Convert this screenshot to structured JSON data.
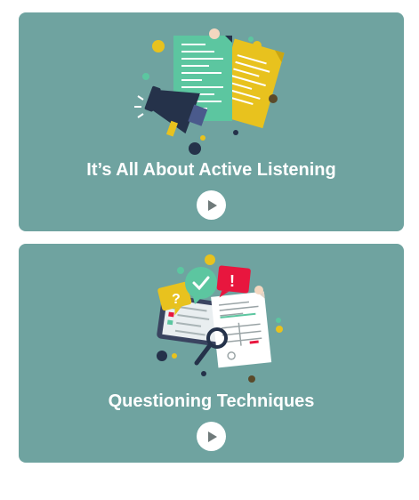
{
  "cards": [
    {
      "title": "It’s All About Active Listening",
      "illustration_icon": "megaphone-documents-icon",
      "play_icon": "play-icon"
    },
    {
      "title": "Questioning Techniques",
      "illustration_icon": "questions-checklist-magnifier-icon",
      "play_icon": "play-icon"
    }
  ],
  "colors": {
    "card_bg": "#6fa3a0",
    "title_text": "#ffffff",
    "play_bg": "#ffffff",
    "play_glyph": "#6f7a7a",
    "accent_green": "#5cc6a0",
    "accent_yellow": "#e8c21e",
    "accent_red": "#e8163e",
    "accent_navy": "#25324a"
  }
}
